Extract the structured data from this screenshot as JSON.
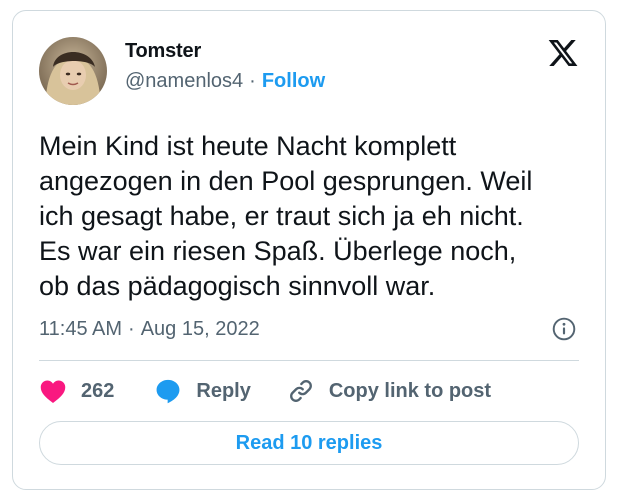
{
  "author": {
    "name": "Tomster",
    "handle": "@namenlos4",
    "separator": "·",
    "follow_label": "Follow"
  },
  "tweet": {
    "lines": [
      "Mein Kind ist heute Nacht komplett",
      "angezogen in den Pool gesprungen. Weil",
      "ich gesagt habe, er traut sich ja eh nicht.",
      "Es war ein riesen Spaß. Überlege noch,",
      "ob das pädagogisch sinnvoll war."
    ],
    "time": "11:45 AM",
    "separator": "·",
    "date": "Aug 15, 2022"
  },
  "actions": {
    "like_count": "262",
    "reply_label": "Reply",
    "copy_link_label": "Copy link to post"
  },
  "read_replies_label": "Read 10 replies",
  "icons": {
    "brand": "x-logo-icon",
    "info": "info-icon",
    "like": "heart-icon",
    "reply": "speech-bubble-icon",
    "copy": "link-icon"
  },
  "colors": {
    "accent": "#1d9bf0",
    "like": "#f91880",
    "text": "#0f1419",
    "muted": "#536471",
    "border": "#cfd9de"
  }
}
